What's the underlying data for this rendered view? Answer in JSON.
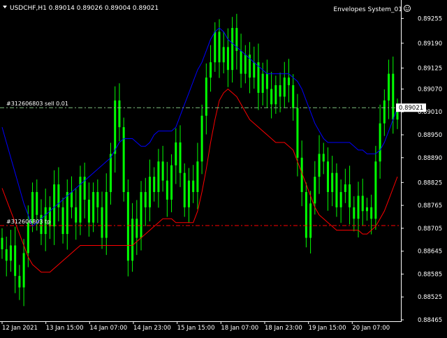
{
  "header": {
    "symbol_line": "USDCHF,H1  0.89014 0.89026 0.89004 0.89021",
    "indicator_name": "Envelopes System_01"
  },
  "orders": {
    "sell_label": "#312606803 sell 0.01",
    "tp_label": "#312606803 tp"
  },
  "current_price": "0.89021",
  "colors": {
    "background": "#000000",
    "candle": "#00ff00",
    "upper_envelope": "#0000ff",
    "lower_envelope": "#ff0000",
    "sell_line": "#7fbf7f",
    "tp_line": "#ff0000",
    "price_tag_bg": "#ffffff",
    "text": "#ffffff"
  },
  "chart_data": {
    "type": "candlestick",
    "y_ticks": [
      "0.89255",
      "0.89190",
      "0.89125",
      "0.89070",
      "0.89010",
      "0.88950",
      "0.88890",
      "0.88825",
      "0.88765",
      "0.88705",
      "0.88645",
      "0.88585",
      "0.88525",
      "0.88465"
    ],
    "x_ticks": [
      "12 Jan 2021",
      "13 Jan 15:00",
      "14 Jan 07:00",
      "14 Jan 23:00",
      "15 Jan 15:00",
      "18 Jan 07:00",
      "18 Jan 23:00",
      "19 Jan 15:00",
      "20 Jan 07:00"
    ],
    "ylim": [
      0.88465,
      0.89285
    ],
    "current_close": 0.89021,
    "sell_price": 0.89021,
    "tp_price": 0.88712,
    "closes": [
      0.8865,
      0.8862,
      0.8866,
      0.8858,
      0.8855,
      0.8864,
      0.8872,
      0.888,
      0.8874,
      0.8869,
      0.8876,
      0.8871,
      0.8882,
      0.8876,
      0.8869,
      0.888,
      0.8876,
      0.8872,
      0.8884,
      0.8878,
      0.8872,
      0.888,
      0.8876,
      0.8868,
      0.888,
      0.889,
      0.8904,
      0.8897,
      0.888,
      0.8862,
      0.8873,
      0.8868,
      0.888,
      0.8876,
      0.8884,
      0.888,
      0.8888,
      0.8883,
      0.8878,
      0.8887,
      0.8893,
      0.8885,
      0.8876,
      0.8883,
      0.888,
      0.8888,
      0.89,
      0.891,
      0.8914,
      0.8922,
      0.8914,
      0.8918,
      0.8912,
      0.8923,
      0.8917,
      0.8911,
      0.8916,
      0.891,
      0.8914,
      0.8906,
      0.8911,
      0.8907,
      0.8903,
      0.8908,
      0.8905,
      0.891,
      0.8908,
      0.8902,
      0.8889,
      0.888,
      0.8868,
      0.8877,
      0.8884,
      0.889,
      0.8888,
      0.888,
      0.8885,
      0.8876,
      0.888,
      0.8882,
      0.8876,
      0.8873,
      0.8879,
      0.8875,
      0.8876,
      0.8873,
      0.8888,
      0.8898,
      0.8904,
      0.8911,
      0.8899,
      0.8902
    ],
    "upper_envelope": [
      0.8897,
      0.8893,
      0.8889,
      0.8885,
      0.8881,
      0.8877,
      0.8874,
      0.8871,
      0.8872,
      0.8873,
      0.8874,
      0.8875,
      0.8876,
      0.8877,
      0.8878,
      0.8879,
      0.888,
      0.8881,
      0.8882,
      0.8883,
      0.8884,
      0.8885,
      0.8886,
      0.8887,
      0.8888,
      0.8889,
      0.8891,
      0.8893,
      0.8894,
      0.8894,
      0.8894,
      0.8893,
      0.8892,
      0.8892,
      0.8893,
      0.8895,
      0.8896,
      0.8896,
      0.8896,
      0.8896,
      0.8897,
      0.89,
      0.8903,
      0.8906,
      0.8909,
      0.8912,
      0.8914,
      0.8917,
      0.892,
      0.8922,
      0.8923,
      0.8922,
      0.892,
      0.8919,
      0.8918,
      0.8917,
      0.8916,
      0.8915,
      0.8914,
      0.8913,
      0.8912,
      0.8911,
      0.8911,
      0.8911,
      0.8911,
      0.8911,
      0.8911,
      0.891,
      0.8909,
      0.8907,
      0.8904,
      0.8901,
      0.8898,
      0.8896,
      0.8894,
      0.8893,
      0.8893,
      0.8893,
      0.8893,
      0.8893,
      0.8893,
      0.8892,
      0.8891,
      0.8891,
      0.889,
      0.889,
      0.889,
      0.8891,
      0.8893,
      0.8896,
      0.8899,
      0.8902
    ],
    "lower_envelope": [
      0.8881,
      0.8878,
      0.8875,
      0.8872,
      0.8869,
      0.8866,
      0.8863,
      0.8861,
      0.886,
      0.8859,
      0.8859,
      0.8859,
      0.886,
      0.8861,
      0.8862,
      0.8863,
      0.8864,
      0.8865,
      0.8866,
      0.8866,
      0.8866,
      0.8866,
      0.8866,
      0.8866,
      0.8866,
      0.8866,
      0.8866,
      0.8866,
      0.8866,
      0.8866,
      0.8866,
      0.8867,
      0.8868,
      0.8869,
      0.887,
      0.8871,
      0.8872,
      0.8873,
      0.8873,
      0.8873,
      0.8872,
      0.8872,
      0.8872,
      0.8872,
      0.8872,
      0.8875,
      0.888,
      0.8886,
      0.8893,
      0.8899,
      0.8904,
      0.8906,
      0.8907,
      0.8906,
      0.8905,
      0.8903,
      0.8901,
      0.8899,
      0.8898,
      0.8897,
      0.8896,
      0.8895,
      0.8894,
      0.8893,
      0.8893,
      0.8893,
      0.8892,
      0.8891,
      0.8888,
      0.8885,
      0.8882,
      0.8879,
      0.8876,
      0.8874,
      0.8873,
      0.8872,
      0.8871,
      0.887,
      0.887,
      0.887,
      0.887,
      0.887,
      0.887,
      0.8869,
      0.8869,
      0.887,
      0.8871,
      0.8873,
      0.8875,
      0.8878,
      0.8881,
      0.8884
    ]
  }
}
